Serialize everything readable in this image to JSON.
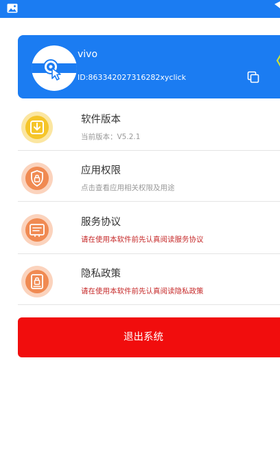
{
  "profile": {
    "name": "vivo",
    "id_text": "ID:863342027316282xyclick"
  },
  "menu": [
    {
      "title": "软件版本",
      "subtitle": "当前版本：V5.2.1",
      "icon": "download-box-icon",
      "color": "#f5c52a"
    },
    {
      "title": "应用权限",
      "subtitle": "点击查看应用相关权限及用途",
      "icon": "shield-lock-icon",
      "color": "#f08a52"
    },
    {
      "title": "服务协议",
      "subtitle": "请在使用本软件前先认真阅读服务协议",
      "icon": "agreement-card-icon",
      "color": "#f08a52"
    },
    {
      "title": "隐私政策",
      "subtitle": "请在使用本软件前先认真阅读隐私政策",
      "icon": "privacy-document-icon",
      "color": "#f08a52"
    }
  ],
  "logout_label": "退出系统",
  "colors": {
    "primary_blue": "#1b7cf2",
    "logout_red": "#f10d0d",
    "notice_red": "#c62a2a",
    "divider": "#e4e4e4"
  }
}
